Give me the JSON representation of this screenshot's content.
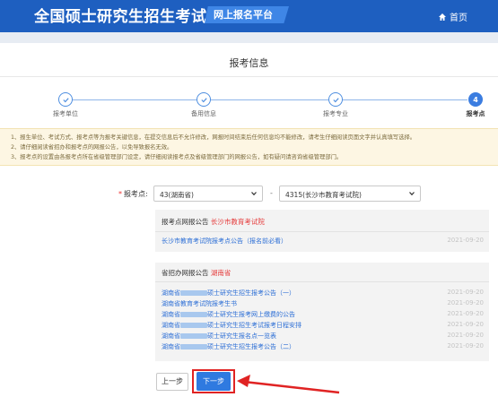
{
  "header": {
    "title": "全国硕士研究生招生考试",
    "badge": "网上报名平台",
    "home_label": "首页"
  },
  "page_title": "报考信息",
  "steps": [
    {
      "label": "报考单位",
      "state": "done"
    },
    {
      "label": "备用信息",
      "state": "done"
    },
    {
      "label": "报考专业",
      "state": "done"
    },
    {
      "label": "报考点",
      "state": "active",
      "number": "4"
    }
  ],
  "notice": [
    "1、报生单位、考试方式、报考点等为报考关键信息，在提交信息后不允许修改，网报时间结束后任何信息均不能修改，请考生仔细阅读页面文字并认真填写选择。",
    "2、请仔细阅读省招办和报考点的网报公告，以免导致报名无效。",
    "3、报考点的设置由各报考点所在省级管理部门设定，请仔细阅读报考点及省级管理部门的网报公告，如有疑问请咨询省级管理部门。"
  ],
  "form": {
    "label": "报考点:",
    "province": "43(湖南省)",
    "dash": "-",
    "site": "4315(长沙市教育考试院)"
  },
  "site_notice": {
    "head": "报考点网报公告",
    "org": "长沙市教育考试院",
    "items": [
      {
        "text": "长沙市教育考试院报考点公告（报名前必看）",
        "date": "2021-09-20"
      }
    ]
  },
  "province_notice": {
    "head": "省招办网报公告",
    "org": "湖南省",
    "items": [
      {
        "pre": "湖南省",
        "post": "硕士研究生招生报考公告（一）",
        "date": "2021-09-20"
      },
      {
        "pre": "湖南省教育考试院报考生书",
        "post": "",
        "date": "2021-09-20"
      },
      {
        "pre": "湖南省",
        "post": "硕士研究生报考网上缴费的公告",
        "date": "2021-09-20"
      },
      {
        "pre": "湖南省",
        "post": "硕士研究生招生考试报考日程安排",
        "date": "2021-09-20"
      },
      {
        "pre": "湖南省",
        "post": "硕士研究生报名点一览表",
        "date": "2021-09-20"
      },
      {
        "pre": "湖南省",
        "post": "硕士研究生招生报考公告（二）",
        "date": "2021-09-20"
      }
    ]
  },
  "buttons": {
    "prev": "上一步",
    "next": "下一步"
  },
  "colors": {
    "brand": "#1e5fc0",
    "accent": "#2f7ae0",
    "highlight": "#e02323"
  }
}
